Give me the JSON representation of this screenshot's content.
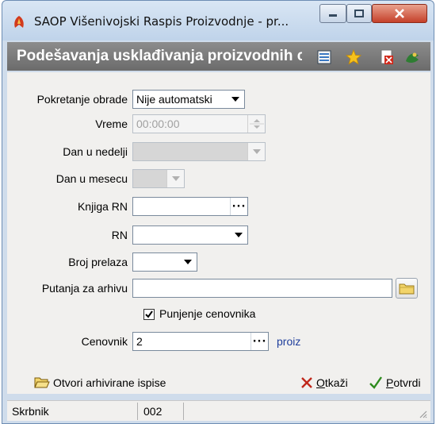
{
  "window": {
    "title": "SAOP  Višenivojski Raspis Proizvodnje - pr..."
  },
  "header": {
    "title": "Podešavanja usklađivanja proizvodnih c..."
  },
  "form": {
    "pokretanje_label": "Pokretanje obrade",
    "pokretanje_value": "Nije automatski",
    "vreme_label": "Vreme",
    "vreme_value": "00:00:00",
    "dan_nedelji_label": "Dan u nedelji",
    "dan_mesecu_label": "Dan u mesecu",
    "knjiga_rn_label": "Knjiga RN",
    "knjiga_rn_value": "",
    "rn_label": "RN",
    "rn_value": "",
    "broj_prelaza_label": "Broj prelaza",
    "broj_prelaza_value": "",
    "putanja_label": "Putanja za arhivu",
    "putanja_value": "",
    "punjenje_label": "Punjenje cenovnika",
    "punjenje_checked": true,
    "cenovnik_label": "Cenovnik",
    "cenovnik_value": "2",
    "cenovnik_link": "proiz",
    "ellipsis": "···"
  },
  "buttons": {
    "open_archive": "Otvori arhivirane ispise",
    "cancel_prefix": "",
    "cancel_underline": "O",
    "cancel_rest": "tkaži",
    "confirm_underline": "P",
    "confirm_rest": "otvrdi"
  },
  "status": {
    "user": "Skrbnik",
    "code": "002"
  },
  "colors": {
    "header_bg": "#7a7a7a",
    "link": "#1f3e9c",
    "cancel_x": "#c0281b",
    "confirm_check": "#2e8b1e"
  }
}
